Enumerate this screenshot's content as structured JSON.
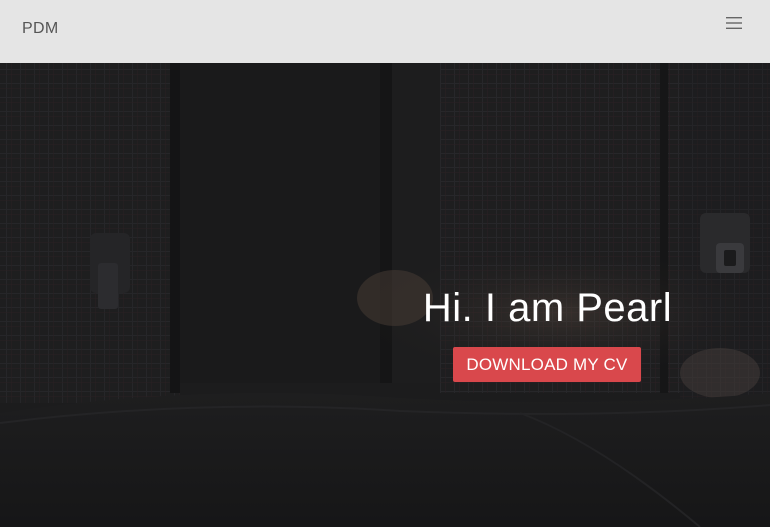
{
  "navbar": {
    "brand": "PDM",
    "menu_icon": "hamburger-menu-icon",
    "menu_glyph": "☰"
  },
  "hero": {
    "title": "Hi. I am Pearl",
    "cv_button_label": "DOWNLOAD MY CV",
    "image_icon": "car-seat-with-cat-photo"
  },
  "colors": {
    "navbar_bg": "#e5e5e5",
    "brand_text": "#555555",
    "hero_overlay": "#1b1b1c",
    "button_bg": "#d9484c",
    "button_text": "#ffffff",
    "title_text": "#ffffff"
  }
}
